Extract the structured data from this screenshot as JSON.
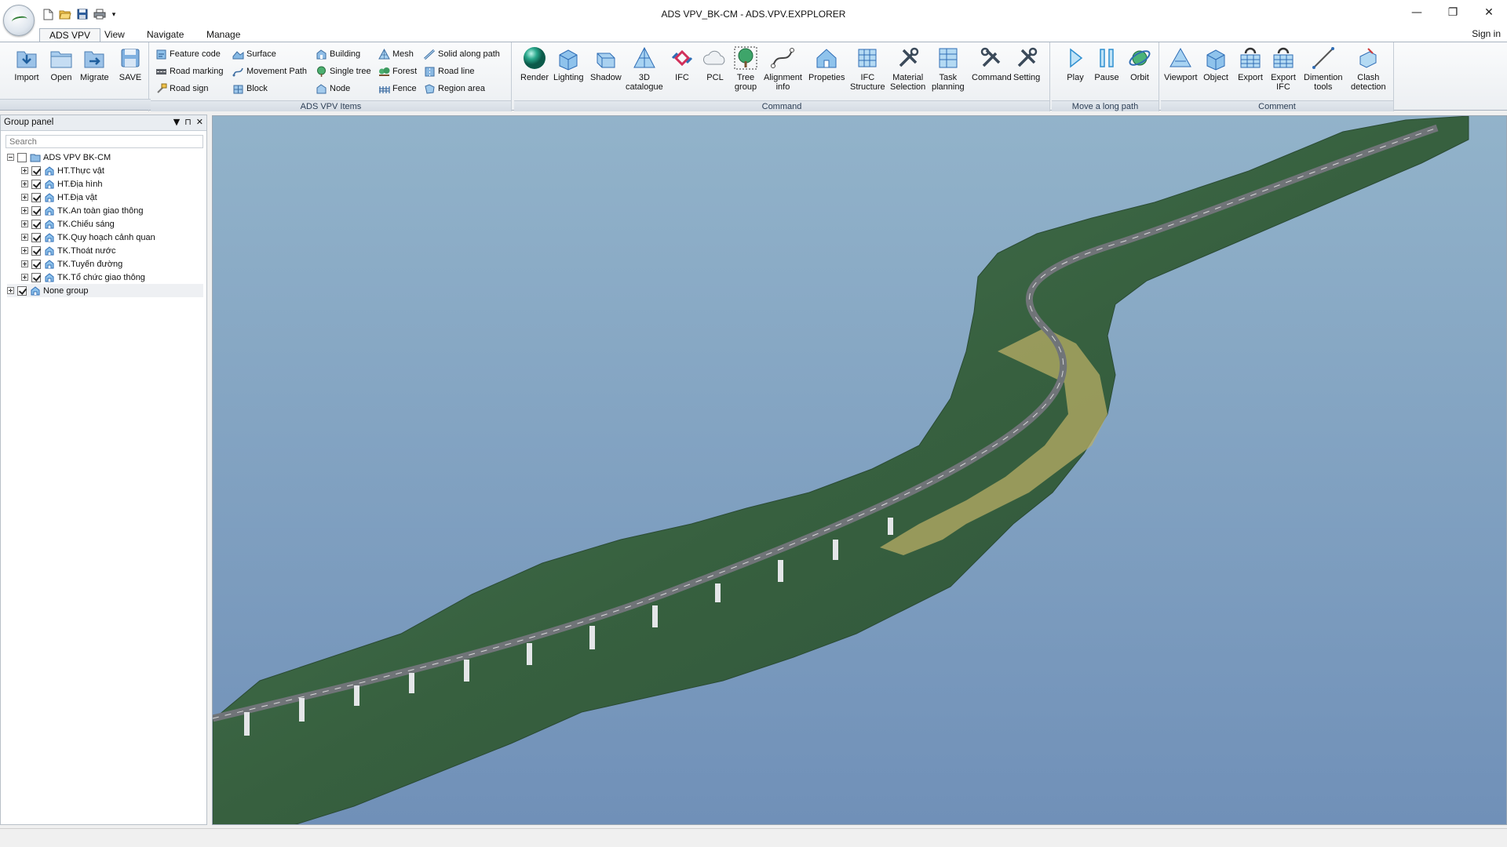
{
  "window": {
    "title": "ADS VPV_BK-CM - ADS.VPV.EXPPLORER",
    "minimize_glyph": "—",
    "restore_glyph": "❐",
    "close_glyph": "✕"
  },
  "quick_access": {
    "more_glyph": "▾"
  },
  "tabs": [
    {
      "label": "ADS VPV",
      "active": true
    },
    {
      "label": "View"
    },
    {
      "label": "Navigate"
    },
    {
      "label": "Manage"
    }
  ],
  "account": {
    "signin_label": "Sign in"
  },
  "ribbon": {
    "file_group": {
      "import": "Import",
      "open": "Open",
      "migrate": "Migrate",
      "save": "SAVE"
    },
    "items_group": {
      "label": "ADS VPV Items",
      "feature_code": "Feature code",
      "road_marking": "Road marking",
      "road_sign": "Road sign",
      "surface": "Surface",
      "movement_path": "Movement Path",
      "block": "Block",
      "building": "Building",
      "single_tree": "Single tree",
      "node": "Node",
      "mesh": "Mesh",
      "forest": "Forest",
      "fence": "Fence",
      "solid_along_path": "Solid along path",
      "road_line": "Road line",
      "region_area": "Region area"
    },
    "command_group": {
      "label": "Command",
      "render": "Render",
      "lighting": "Lighting",
      "shadow": "Shadow",
      "catalogue_1": "3D",
      "catalogue_2": "catalogue",
      "ifc": "IFC",
      "pcl": "PCL",
      "tree_group_1": "Tree",
      "tree_group_2": "group",
      "alignment_1": "Alignment",
      "alignment_2": "info",
      "propeties": "Propeties",
      "ifc_structure_1": "IFC",
      "ifc_structure_2": "Structure",
      "material_1": "Material",
      "material_2": "Selection",
      "task_1": "Task",
      "task_2": "planning",
      "command": "Command",
      "setting": "Setting"
    },
    "path_group": {
      "label": "Move a long path",
      "play": "Play",
      "pause": "Pause",
      "orbit": "Orbit"
    },
    "comment_group": {
      "label": "Comment",
      "viewport": "Viewport",
      "object": "Object",
      "export": "Export",
      "export_ifc_1": "Export",
      "export_ifc_2": "IFC",
      "dimention_1": "Dimention",
      "dimention_2": "tools",
      "clash_1": "Clash",
      "clash_2": "detection"
    }
  },
  "group_panel": {
    "title": "Group panel",
    "dropdown_glyph": "▼",
    "pin_glyph": "⊓",
    "close_glyph": "✕",
    "search_placeholder": "Search",
    "tree": [
      {
        "label": "ADS VPV BK-CM",
        "level": 0,
        "expanded": true,
        "checked": false
      },
      {
        "label": "HT.Thực vật",
        "level": 1,
        "checked": true
      },
      {
        "label": "HT.Địa hình",
        "level": 1,
        "checked": true
      },
      {
        "label": "HT.Địa vật",
        "level": 1,
        "checked": true
      },
      {
        "label": "TK.An toàn giao thông",
        "level": 1,
        "checked": true
      },
      {
        "label": "TK.Chiếu sáng",
        "level": 1,
        "checked": true
      },
      {
        "label": "TK.Quy hoạch cảnh quan",
        "level": 1,
        "checked": true
      },
      {
        "label": "TK.Thoát nước",
        "level": 1,
        "checked": true
      },
      {
        "label": "TK.Tuyến đường",
        "level": 1,
        "checked": true
      },
      {
        "label": "TK.Tổ chức giao thông",
        "level": 1,
        "checked": true
      },
      {
        "label": "None group",
        "level": 0,
        "checked": true,
        "selected": true
      }
    ]
  },
  "colors": {
    "accent": "#2f6db5",
    "sky_top": "#8fb0c8",
    "sky_bottom": "#6f8fb6",
    "terrain": "#3f6e4a",
    "road": "#6a6e72"
  }
}
